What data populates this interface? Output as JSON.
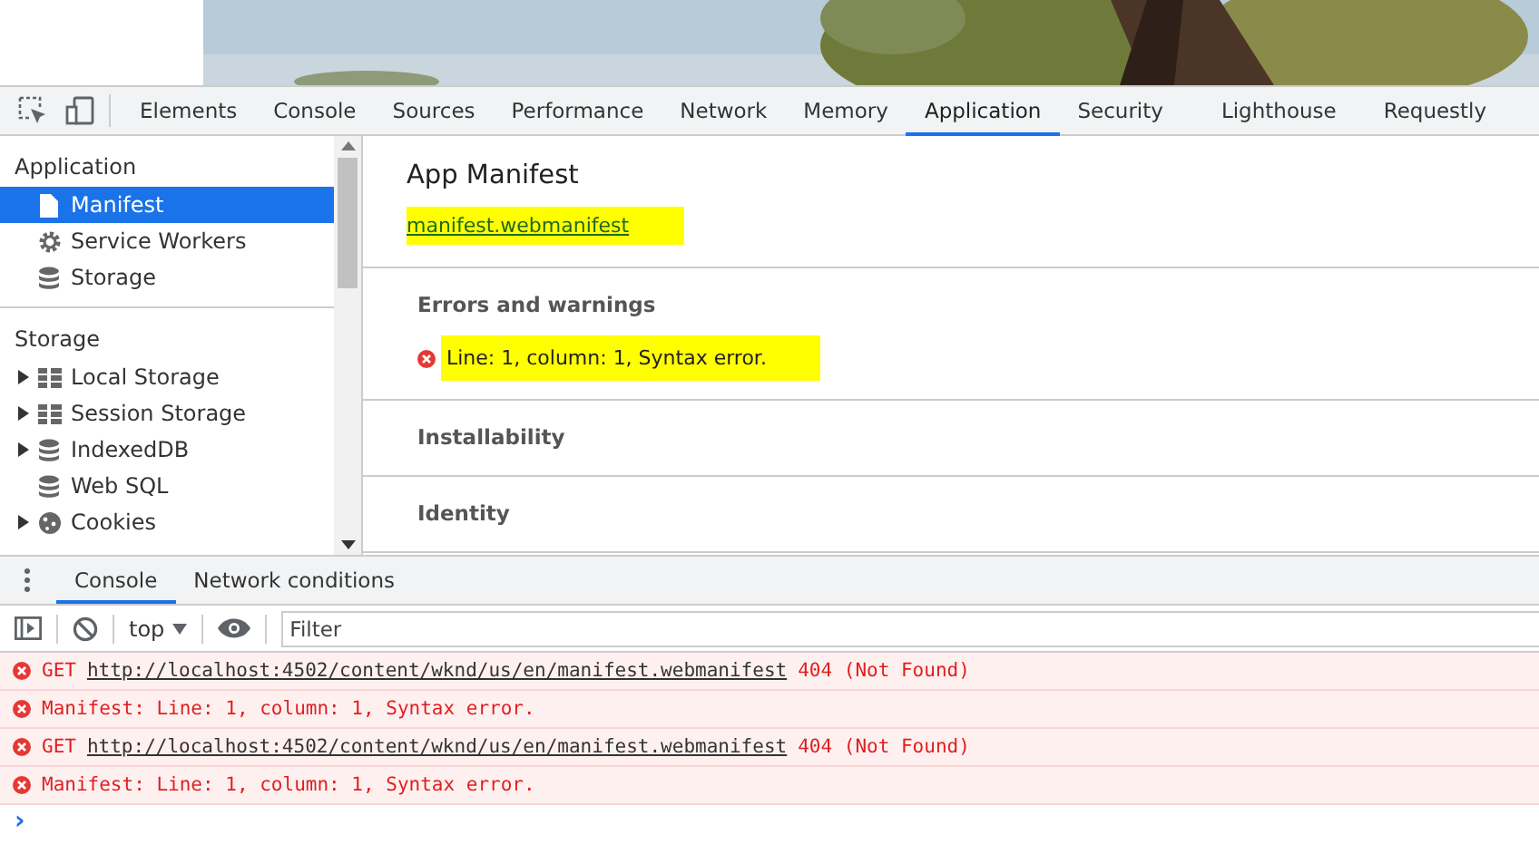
{
  "toolbar": {
    "tabs": [
      {
        "label": "Elements",
        "selected": false
      },
      {
        "label": "Console",
        "selected": false
      },
      {
        "label": "Sources",
        "selected": false
      },
      {
        "label": "Performance",
        "selected": false
      },
      {
        "label": "Network",
        "selected": false
      },
      {
        "label": "Memory",
        "selected": false
      },
      {
        "label": "Application",
        "selected": true
      },
      {
        "label": "Security",
        "selected": false
      },
      {
        "label": "Lighthouse",
        "selected": false
      },
      {
        "label": "Requestly",
        "selected": false
      }
    ]
  },
  "sidebar": {
    "sections": [
      {
        "title": "Application",
        "items": [
          {
            "label": "Manifest",
            "kind": "file",
            "selected": true,
            "expandable": false
          },
          {
            "label": "Service Workers",
            "kind": "gear",
            "selected": false,
            "expandable": false
          },
          {
            "label": "Storage",
            "kind": "database",
            "selected": false,
            "expandable": false
          }
        ]
      },
      {
        "title": "Storage",
        "items": [
          {
            "label": "Local Storage",
            "kind": "grid",
            "selected": false,
            "expandable": true
          },
          {
            "label": "Session Storage",
            "kind": "grid",
            "selected": false,
            "expandable": true
          },
          {
            "label": "IndexedDB",
            "kind": "database",
            "selected": false,
            "expandable": true
          },
          {
            "label": "Web SQL",
            "kind": "database",
            "selected": false,
            "expandable": false
          },
          {
            "label": "Cookies",
            "kind": "cookie",
            "selected": false,
            "expandable": true
          }
        ]
      }
    ]
  },
  "manifest": {
    "title": "App Manifest",
    "link": {
      "text": "manifest.webmanifest",
      "highlighted": true
    },
    "sections": [
      {
        "title": "Errors and warnings",
        "errors": [
          {
            "text": "Line: 1, column: 1, Syntax error.",
            "highlighted": true
          }
        ]
      },
      {
        "title": "Installability"
      },
      {
        "title": "Identity"
      }
    ]
  },
  "drawer": {
    "tabs": [
      {
        "label": "Console",
        "selected": true
      },
      {
        "label": "Network conditions",
        "selected": false
      }
    ],
    "context": "top",
    "filter": {
      "placeholder": "Filter"
    },
    "messages": [
      {
        "kind": "request",
        "method": "GET",
        "url": "http://localhost:4502/content/wknd/us/en/manifest.webmanifest",
        "status": "404 (Not Found)"
      },
      {
        "kind": "text",
        "text": "Manifest: Line: 1, column: 1, Syntax error."
      },
      {
        "kind": "request",
        "method": "GET",
        "url": "http://localhost:4502/content/wknd/us/en/manifest.webmanifest",
        "status": "404 (Not Found)"
      },
      {
        "kind": "text",
        "text": "Manifest: Line: 1, column: 1, Syntax error."
      }
    ],
    "prompt": "›"
  }
}
